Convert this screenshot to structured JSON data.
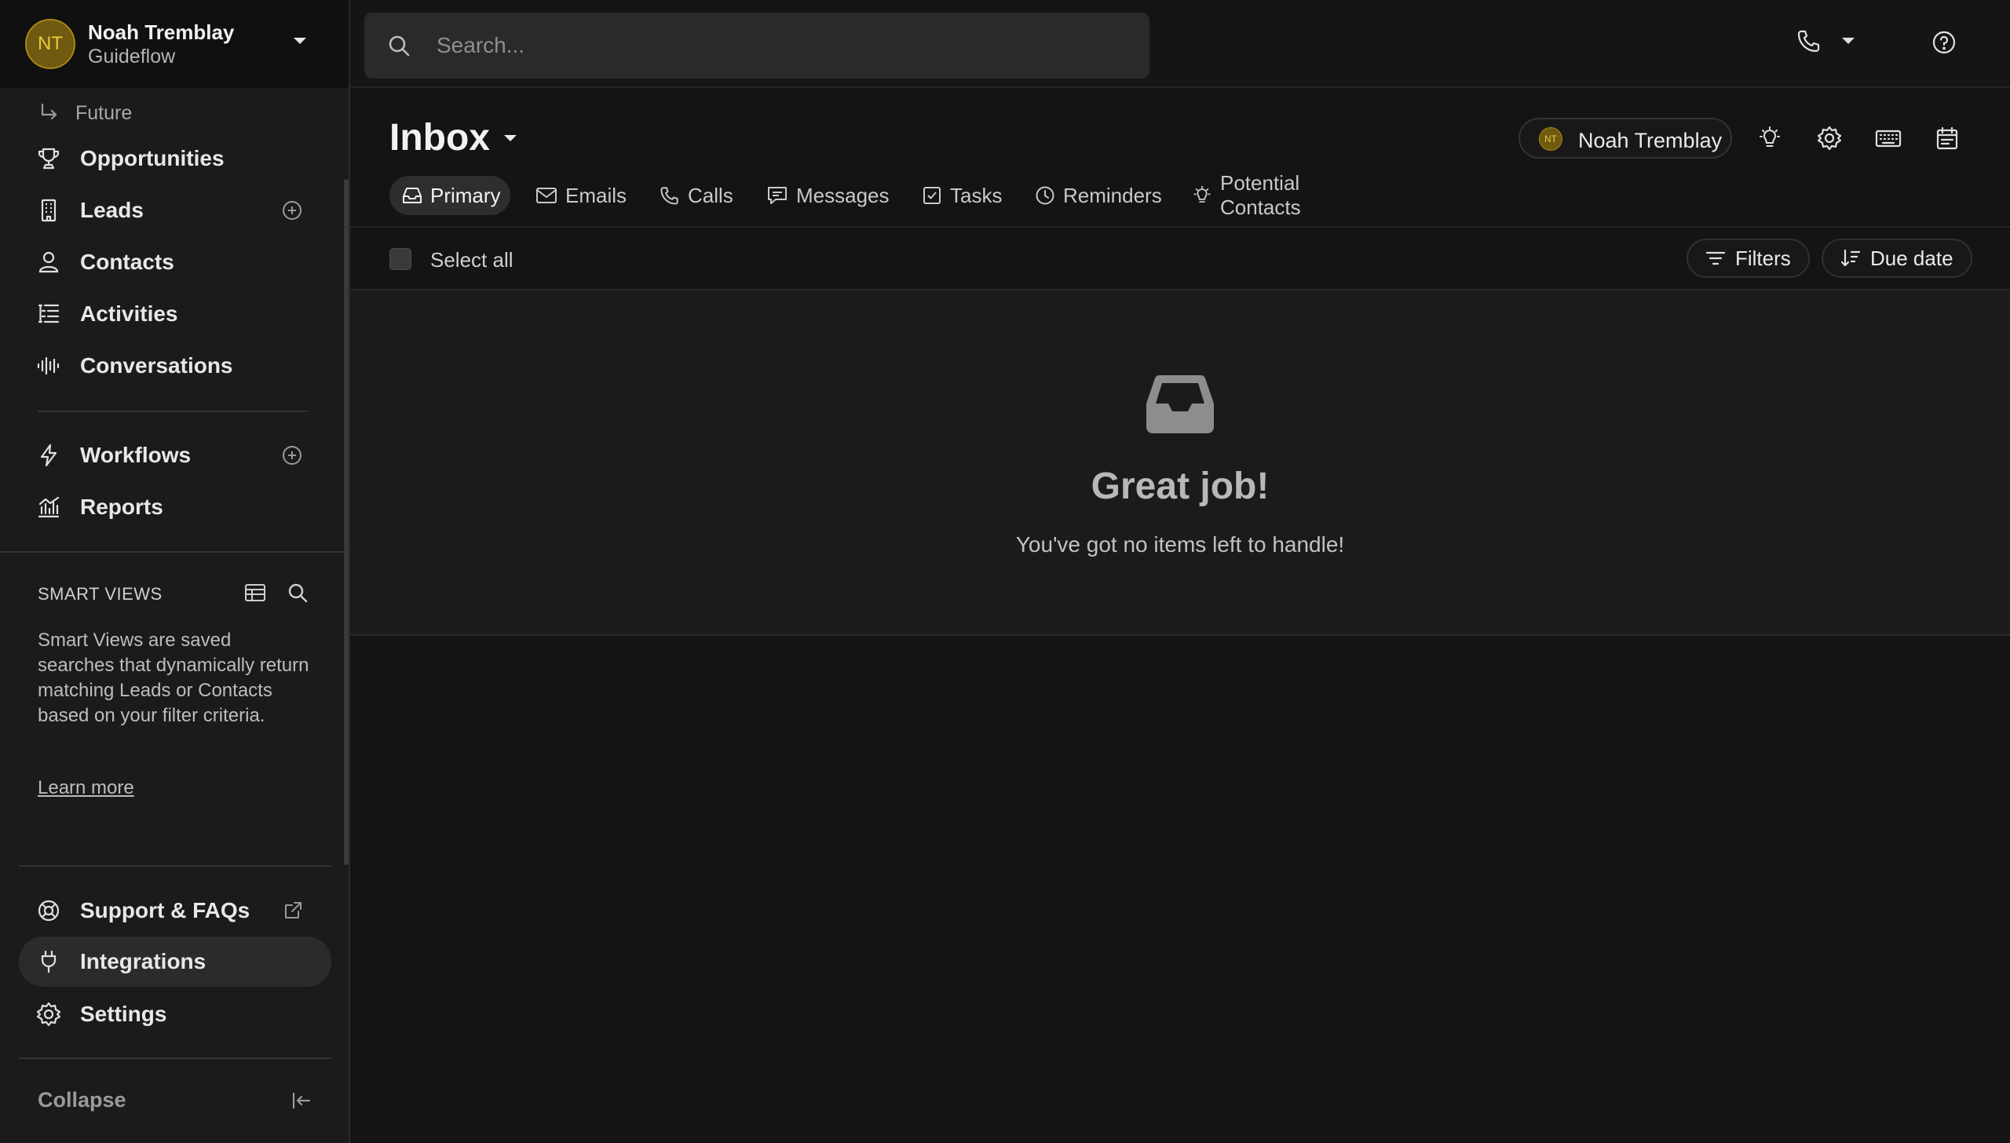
{
  "sidebar": {
    "user": {
      "initials": "NT",
      "name": "Noah Tremblay",
      "org": "Guideflow"
    },
    "future_label": "Future",
    "nav_main": [
      {
        "label": "Opportunities",
        "icon": "trophy-icon",
        "has_add": false
      },
      {
        "label": "Leads",
        "icon": "building-icon",
        "has_add": true
      },
      {
        "label": "Contacts",
        "icon": "person-icon",
        "has_add": false
      },
      {
        "label": "Activities",
        "icon": "activity-list-icon",
        "has_add": false
      },
      {
        "label": "Conversations",
        "icon": "audio-wave-icon",
        "has_add": false
      }
    ],
    "nav_secondary": [
      {
        "label": "Workflows",
        "icon": "lightning-icon",
        "has_add": true
      },
      {
        "label": "Reports",
        "icon": "chart-icon",
        "has_add": false
      }
    ],
    "smart_views": {
      "title": "SMART VIEWS",
      "description": "Smart Views are saved searches that dynamically return matching Leads or Contacts based on your filter criteria.",
      "learn_more": "Learn more"
    },
    "nav_bottom": [
      {
        "label": "Support & FAQs",
        "icon": "lifebuoy-icon",
        "external": true
      },
      {
        "label": "Integrations",
        "icon": "plug-icon",
        "active": true
      },
      {
        "label": "Settings",
        "icon": "gear-icon"
      }
    ],
    "collapse_label": "Collapse"
  },
  "topbar": {
    "search_placeholder": "Search..."
  },
  "inbox": {
    "title": "Inbox",
    "user_chip": {
      "initials": "NT",
      "name": "Noah Tremblay"
    },
    "tabs": [
      {
        "label": "Primary",
        "icon": "inbox-tray-icon",
        "active": true
      },
      {
        "label": "Emails",
        "icon": "envelope-icon"
      },
      {
        "label": "Calls",
        "icon": "phone-icon"
      },
      {
        "label": "Messages",
        "icon": "message-icon"
      },
      {
        "label": "Tasks",
        "icon": "checkbox-icon"
      },
      {
        "label": "Reminders",
        "icon": "clock-icon"
      },
      {
        "label": "Potential Contacts",
        "icon": "lightbulb-icon"
      }
    ],
    "select_all_label": "Select all",
    "filters_label": "Filters",
    "sort_label": "Due date",
    "empty_state": {
      "title": "Great job!",
      "subtitle": "You've got no items left to handle!"
    }
  },
  "colors": {
    "avatar_bg": "#6e5a10",
    "avatar_text": "#e9c93a",
    "background": "#141414",
    "sidebar": "#1b1b1b"
  }
}
